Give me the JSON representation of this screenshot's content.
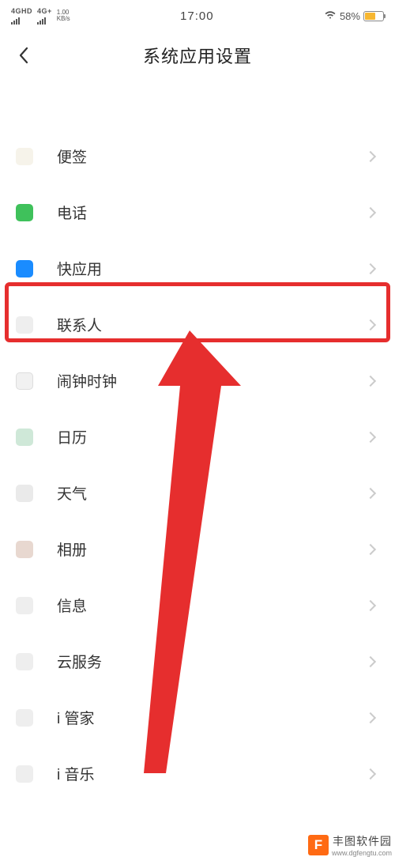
{
  "status": {
    "left_hd1": "4GHD",
    "left_hd2": "4G+",
    "speed_top": "1.00",
    "speed_bottom": "KB/s",
    "time": "17:00",
    "battery": "58%"
  },
  "header": {
    "title": "系统应用设置"
  },
  "items": [
    {
      "id": "notes",
      "label": "便签",
      "iconClass": "icon-notes"
    },
    {
      "id": "phone",
      "label": "电话",
      "iconClass": "icon-phone"
    },
    {
      "id": "quickapp",
      "label": "快应用",
      "iconClass": "icon-quickapp"
    },
    {
      "id": "contacts",
      "label": "联系人",
      "iconClass": "icon-contacts"
    },
    {
      "id": "clock",
      "label": "闹钟时钟",
      "iconClass": "icon-clock"
    },
    {
      "id": "calendar",
      "label": "日历",
      "iconClass": "icon-calendar"
    },
    {
      "id": "weather",
      "label": "天气",
      "iconClass": "icon-weather"
    },
    {
      "id": "album",
      "label": "相册",
      "iconClass": "icon-album"
    },
    {
      "id": "message",
      "label": "信息",
      "iconClass": "icon-message"
    },
    {
      "id": "cloud",
      "label": "云服务",
      "iconClass": "icon-cloud"
    },
    {
      "id": "manager",
      "label": "i 管家",
      "iconClass": "icon-manager"
    },
    {
      "id": "music",
      "label": "i 音乐",
      "iconClass": "icon-music"
    }
  ],
  "watermark": {
    "logo": "F",
    "name": "丰图软件园",
    "url": "www.dgfengtu.com"
  },
  "annotation": {
    "highlight_item": "contacts",
    "arrow_color": "#e62e2e"
  }
}
